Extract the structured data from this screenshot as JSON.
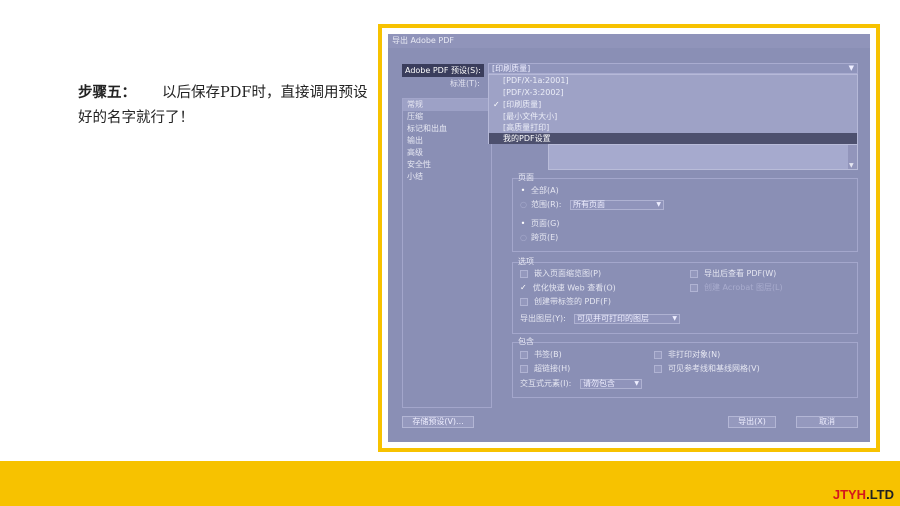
{
  "instruction": {
    "step": "步骤五：",
    "text": "以后保存PDF时，直接调用预设好的名字就行了！"
  },
  "dialog": {
    "title": "导出 Adobe PDF",
    "preset_label": "Adobe PDF 预设(S):",
    "preset_value": "[印刷质量]",
    "standard_label": "标准(T):",
    "dropdown_items": [
      {
        "label": "[PDF/X-1a:2001]",
        "checked": false
      },
      {
        "label": "[PDF/X-3:2002]",
        "checked": false
      },
      {
        "label": "[印刷质量]",
        "checked": true
      },
      {
        "label": "[最小文件大小]",
        "checked": false
      },
      {
        "label": "[高质量打印]",
        "checked": false
      }
    ],
    "dropdown_highlight": "我的PDF设置",
    "sidebar": [
      "常规",
      "压缩",
      "标记和出血",
      "输出",
      "高级",
      "安全性",
      "小结"
    ],
    "pages": {
      "title": "页面",
      "all": "全部(A)",
      "range": "范围(R):",
      "range_value": "所有页面",
      "pages": "页面(G)",
      "spreads": "跨页(E)"
    },
    "options": {
      "title": "选项",
      "embed_thumbnails": "嵌入页面缩览图(P)",
      "optimize_web": "优化快速 Web 查看(O)",
      "tagged_pdf": "创建带标签的 PDF(F)",
      "view_after": "导出后查看 PDF(W)",
      "acrobat_layers": "创建 Acrobat 图层(L)",
      "export_layers_label": "导出图层(Y):",
      "export_layers_value": "可见并可打印的图层"
    },
    "include": {
      "title": "包含",
      "bookmarks": "书签(B)",
      "hyperlinks": "超链接(H)",
      "nonprinting": "非打印对象(N)",
      "guides": "可见参考线和基线网格(V)",
      "interactive_label": "交互式元素(I):",
      "interactive_value": "请勿包含"
    },
    "buttons": {
      "save_preset": "存储预设(V)...",
      "export": "导出(X)",
      "cancel": "取消"
    }
  },
  "logo": {
    "part1": "JTYH",
    "part2": ".LTD"
  },
  "colors": {
    "accent": "#f7c200",
    "logo_red": "#d4171c",
    "dialog_bg": "#8a8fb5"
  }
}
